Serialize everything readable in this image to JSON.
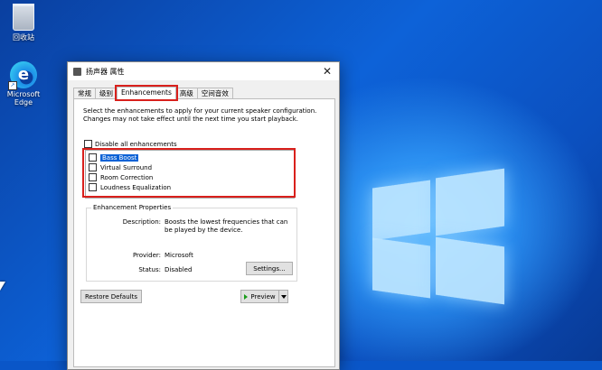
{
  "desktop": {
    "icons": [
      {
        "label": "回收站"
      },
      {
        "label": "Microsoft Edge"
      }
    ]
  },
  "dialog": {
    "title": "扬声器 属性",
    "close_glyph": "✕",
    "tabs": [
      {
        "label": "常规",
        "active": false
      },
      {
        "label": "级别",
        "active": false
      },
      {
        "label": "Enhancements",
        "active": true
      },
      {
        "label": "高级",
        "active": false
      },
      {
        "label": "空间音效",
        "active": false
      }
    ],
    "description": "Select the enhancements to apply for your current speaker configuration. Changes may not take effect until the next time you start playback.",
    "disable_all_label": "Disable all enhancements",
    "enhancements": [
      {
        "label": "Bass Boost",
        "checked": false,
        "selected": true
      },
      {
        "label": "Virtual Surround",
        "checked": false,
        "selected": false
      },
      {
        "label": "Room Correction",
        "checked": false,
        "selected": false
      },
      {
        "label": "Loudness Equalization",
        "checked": false,
        "selected": false
      }
    ],
    "properties": {
      "group_title": "Enhancement Properties",
      "description_label": "Description:",
      "description_value": "Boosts the lowest frequencies that can be played by the device.",
      "provider_label": "Provider:",
      "provider_value": "Microsoft",
      "status_label": "Status:",
      "status_value": "Disabled",
      "settings_button": "Settings..."
    },
    "restore_defaults_button": "Restore Defaults",
    "preview_button": "Preview"
  }
}
